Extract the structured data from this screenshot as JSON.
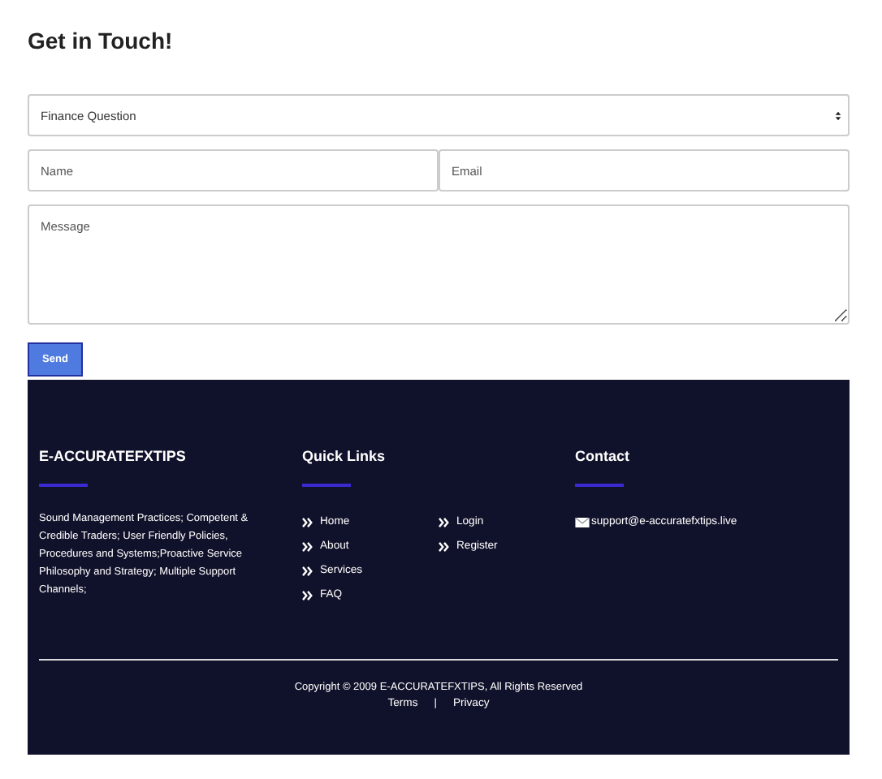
{
  "heading": "Get in Touch!",
  "form": {
    "subject": {
      "value": "Finance Question"
    },
    "name": {
      "placeholder": "Name"
    },
    "email": {
      "placeholder": "Email"
    },
    "message": {
      "placeholder": "Message"
    },
    "submit": "Send"
  },
  "footer": {
    "brand": {
      "title": "E-ACCURATEFXTIPS",
      "text": "Sound Management Practices; Competent & Credible Traders; User Friendly Policies, Procedures and Systems;Proactive Service Philosophy and Strategy; Multiple Support Channels;"
    },
    "quick_links": {
      "title": "Quick Links",
      "columns": [
        [
          "Home",
          "About",
          "Services",
          "FAQ"
        ],
        [
          "Login",
          "Register"
        ]
      ]
    },
    "contact": {
      "title": "Contact",
      "email": "support@e-accuratefxtips.live"
    },
    "copyright": "Copyright © 2009 E-ACCURATEFXTIPS, All Rights Reserved",
    "bottom_links": [
      {
        "label": "Terms"
      },
      {
        "label": "|",
        "kind": "separator"
      },
      {
        "label": "Privacy"
      }
    ]
  }
}
